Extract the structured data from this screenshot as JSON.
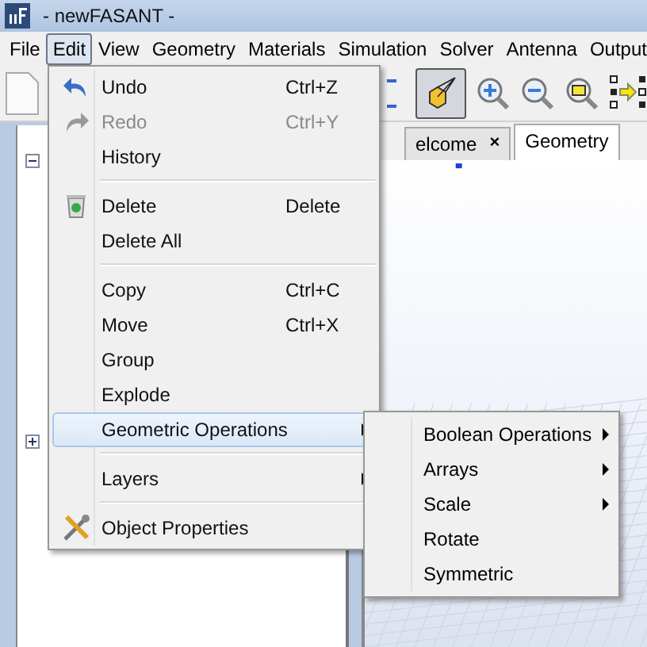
{
  "window": {
    "title": "- newFASANT -"
  },
  "menubar": [
    {
      "label": "File",
      "selected": false
    },
    {
      "label": "Edit",
      "selected": true
    },
    {
      "label": "View",
      "selected": false
    },
    {
      "label": "Geometry",
      "selected": false
    },
    {
      "label": "Materials",
      "selected": false
    },
    {
      "label": "Simulation",
      "selected": false
    },
    {
      "label": "Solver",
      "selected": false
    },
    {
      "label": "Antenna",
      "selected": false
    },
    {
      "label": "Output",
      "selected": false
    }
  ],
  "toolbar": {
    "view_3d_pressed": true
  },
  "tabs": [
    {
      "label": "elcome",
      "selected": false,
      "close": "×"
    },
    {
      "label": "Geometry",
      "selected": true
    }
  ],
  "edit_menu": [
    {
      "kind": "item",
      "label": "Undo",
      "shortcut": "Ctrl+Z",
      "disabled": false,
      "selected": false
    },
    {
      "kind": "item",
      "label": "Redo",
      "shortcut": "Ctrl+Y",
      "disabled": true,
      "selected": false
    },
    {
      "kind": "item",
      "label": "History",
      "disabled": false,
      "selected": false
    },
    {
      "kind": "separator"
    },
    {
      "kind": "item",
      "label": "Delete",
      "shortcut": "Delete",
      "disabled": false,
      "selected": false
    },
    {
      "kind": "item",
      "label": "Delete All",
      "disabled": false,
      "selected": false
    },
    {
      "kind": "separator"
    },
    {
      "kind": "item",
      "label": "Copy",
      "shortcut": "Ctrl+C",
      "disabled": false,
      "selected": false
    },
    {
      "kind": "item",
      "label": "Move",
      "shortcut": "Ctrl+X",
      "disabled": false,
      "selected": false
    },
    {
      "kind": "item",
      "label": "Group",
      "disabled": false,
      "selected": false
    },
    {
      "kind": "item",
      "label": "Explode",
      "disabled": false,
      "selected": false
    },
    {
      "kind": "submenu",
      "label": "Geometric Operations",
      "disabled": false,
      "selected": true
    },
    {
      "kind": "separator"
    },
    {
      "kind": "submenu",
      "label": "Layers",
      "disabled": false,
      "selected": false
    },
    {
      "kind": "separator"
    },
    {
      "kind": "item",
      "label": "Object Properties",
      "disabled": false,
      "selected": false
    }
  ],
  "geometric_operations_menu": [
    {
      "kind": "submenu",
      "label": "Boolean Operations"
    },
    {
      "kind": "submenu",
      "label": "Arrays"
    },
    {
      "kind": "submenu",
      "label": "Scale"
    },
    {
      "kind": "item",
      "label": "Rotate"
    },
    {
      "kind": "item",
      "label": "Symmetric"
    }
  ]
}
